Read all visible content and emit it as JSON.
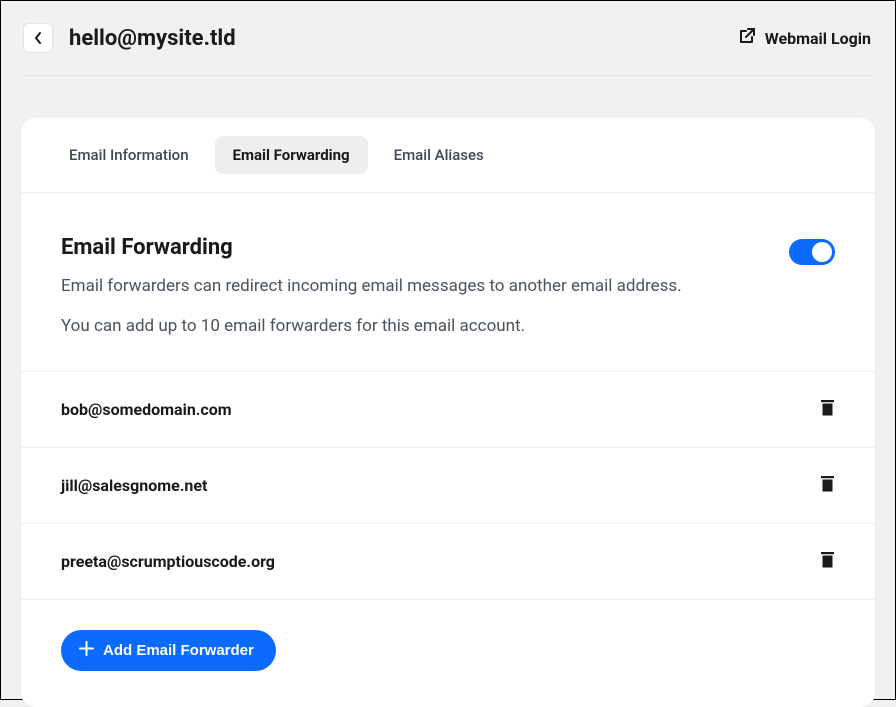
{
  "header": {
    "title": "hello@mysite.tld",
    "webmail_label": "Webmail Login"
  },
  "tabs": [
    {
      "label": "Email Information",
      "active": false
    },
    {
      "label": "Email Forwarding",
      "active": true
    },
    {
      "label": "Email Aliases",
      "active": false
    }
  ],
  "section": {
    "title": "Email Forwarding",
    "description": "Email forwarders can redirect incoming email messages to another email address.",
    "note": "You can add up to 10 email forwarders for this email account.",
    "toggle_on": true
  },
  "forwarders": [
    {
      "email": "bob@somedomain.com"
    },
    {
      "email": "jill@salesgnome.net"
    },
    {
      "email": "preeta@scrumptiouscode.org"
    }
  ],
  "actions": {
    "add_label": "Add Email Forwarder"
  }
}
